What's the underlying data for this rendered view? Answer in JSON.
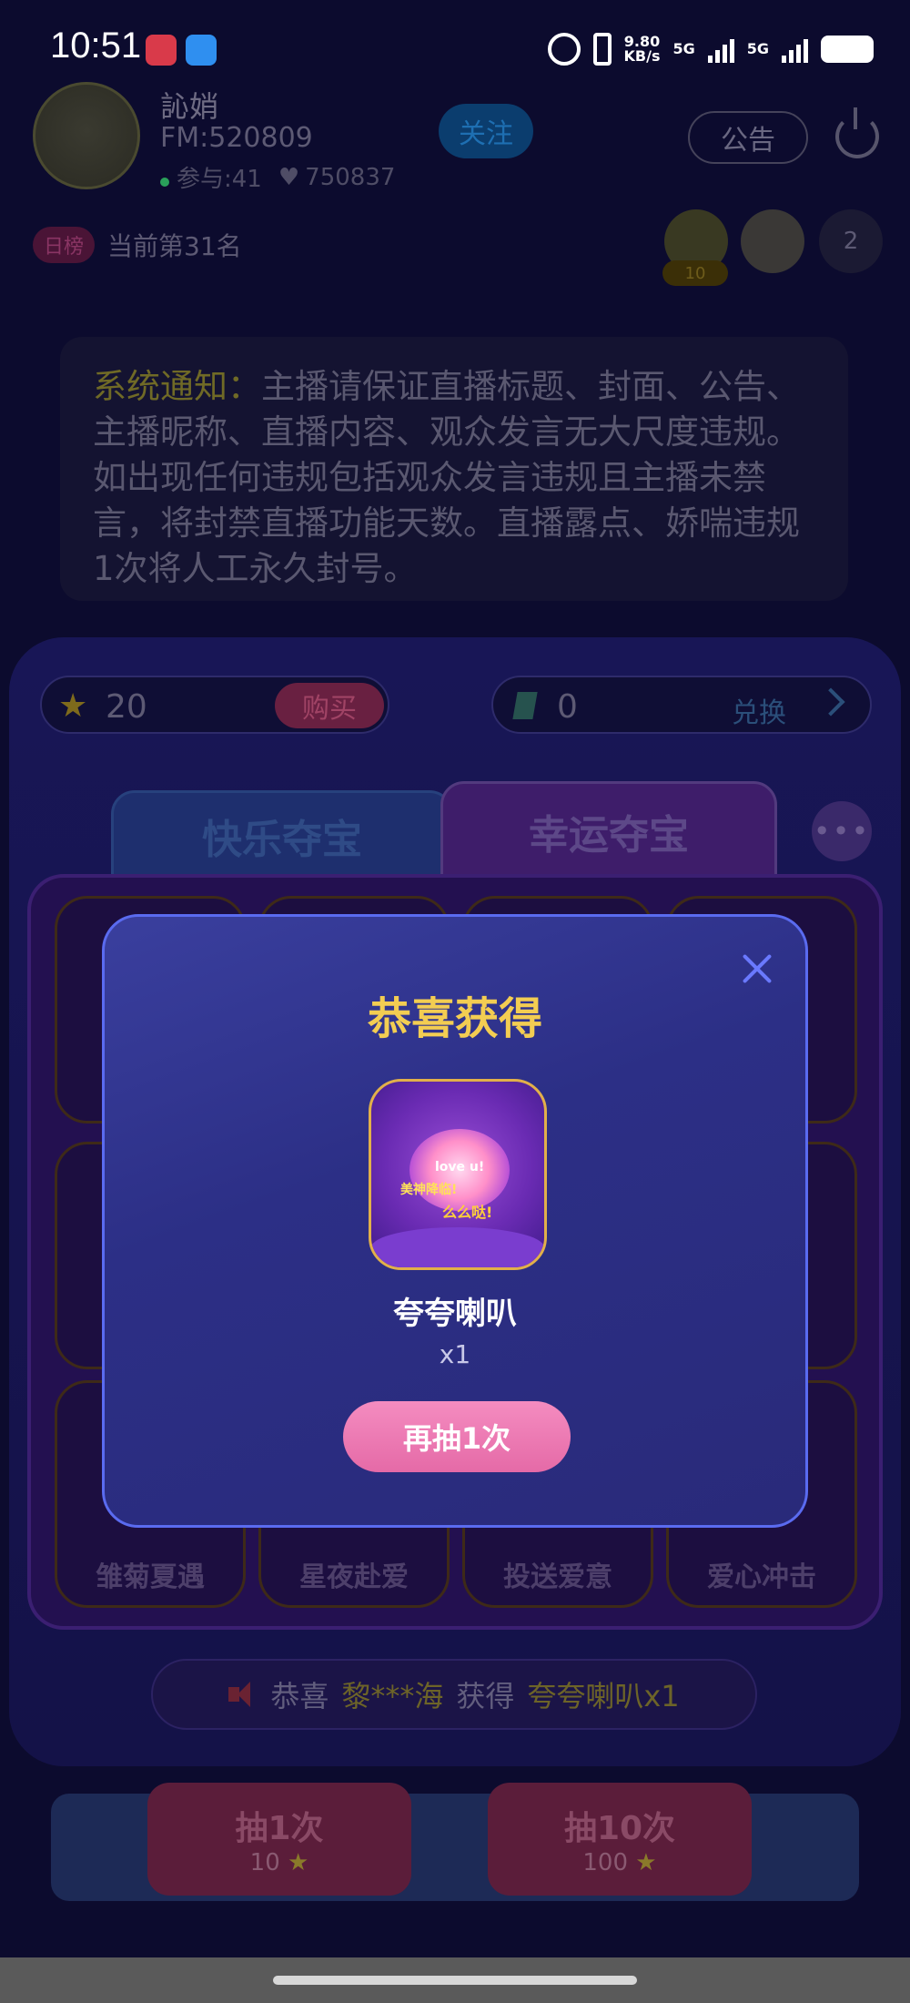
{
  "status_bar": {
    "time": "10:51",
    "net_speed_value": "9.80",
    "net_speed_unit": "KB/s",
    "sim1": "5G",
    "sim2": "5G"
  },
  "anchor": {
    "name": "訫娋",
    "fm": "FM:520809",
    "participants": "参与:41",
    "likes": "750837",
    "follow_label": "关注",
    "notice_label": "公告"
  },
  "rank": {
    "tag": "日榜",
    "text": "当前第31名"
  },
  "viewers": {
    "badge": "10",
    "count": "2"
  },
  "system_notice": {
    "label": "系统通知：",
    "text": "主播请保证直播标题、封面、公告、主播昵称、直播内容、观众发言无大尺度违规。如出现任何违规包括观众发言违规且主播未禁言，将封禁直播功能天数。直播露点、娇喘违规1次将人工永久封号。"
  },
  "wallet": {
    "stars": "20",
    "buy_label": "购买",
    "gems": "0",
    "exchange_label": "兑换"
  },
  "tabs": [
    {
      "label": "快乐夺宝"
    },
    {
      "label": "幸运夺宝"
    }
  ],
  "grid_bottom_labels": [
    "雏菊夏遇",
    "星夜赴爱",
    "投送爱意",
    "爱心冲击"
  ],
  "ticker": {
    "prefix": "恭喜",
    "user": "黎***海",
    "middle": "获得",
    "item": "夸夸喇叭x1"
  },
  "draw_buttons": [
    {
      "label": "抽1次",
      "price": "10"
    },
    {
      "label": "抽10次",
      "price": "100"
    }
  ],
  "modal": {
    "title": "恭喜获得",
    "prize_name": "夸夸喇叭",
    "prize_qty": "x1",
    "again_label": "再抽1次",
    "prize_art_text_1": "love u!",
    "prize_art_text_2": "美神降临!",
    "prize_art_text_3": "么么哒!"
  },
  "colors": {
    "modal_title": "#f3cd52",
    "again_button": "#e56aa7",
    "modal_border": "#5a6bf0"
  }
}
